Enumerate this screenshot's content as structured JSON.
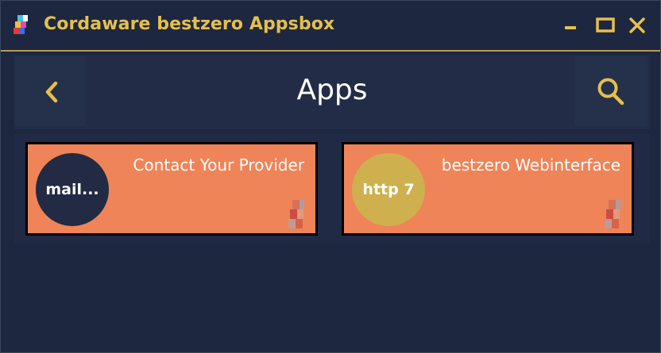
{
  "window": {
    "title": "Cordaware bestzero Appsbox"
  },
  "header": {
    "title": "Apps",
    "back_icon": "chevron-left-icon",
    "search_icon": "search-icon"
  },
  "apps": [
    {
      "badge": "mail...",
      "title": "Contact Your Provider",
      "badge_color": "#222a44"
    },
    {
      "badge": "http 7",
      "title": "bestzero Webinterface",
      "badge_color": "#cfb04f"
    }
  ],
  "colors": {
    "accent": "#e6bf4c",
    "background": "#1d2740",
    "tile": "#ef8458"
  }
}
